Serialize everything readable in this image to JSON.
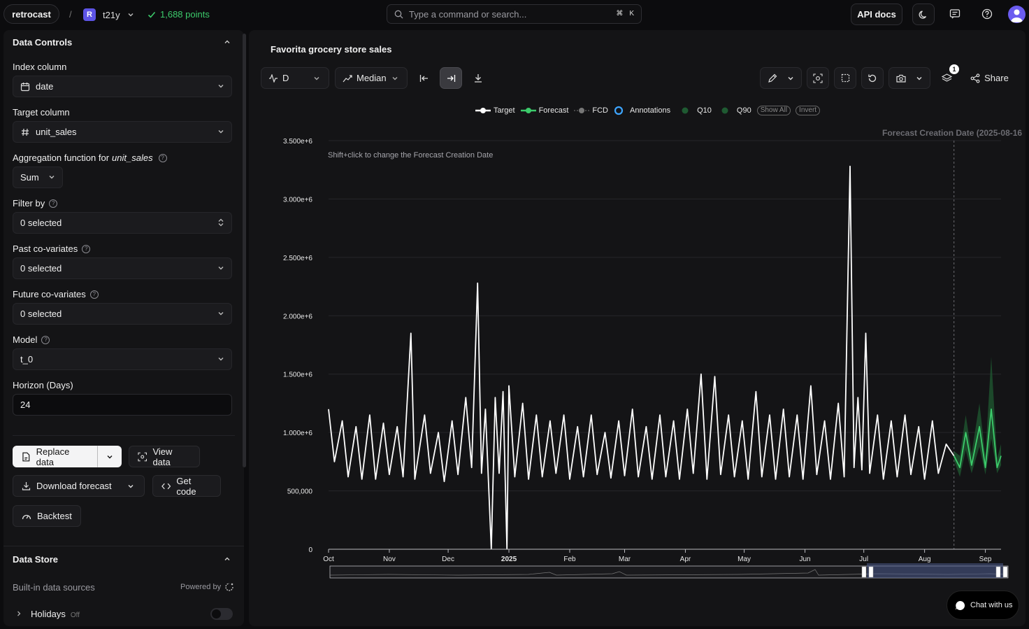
{
  "topbar": {
    "brand": "retrocast",
    "separator": "/",
    "workspace_badge": "R",
    "workspace": "t21y",
    "points": "1,688 points",
    "search_placeholder": "Type a command or search...",
    "shortcut_key_1": "⌘",
    "shortcut_key_2": "K",
    "api_docs": "API docs",
    "points_color": "#3ccb6b"
  },
  "sidebar": {
    "data_controls_title": "Data Controls",
    "index_column_label": "Index column",
    "index_column_value": "date",
    "target_column_label": "Target column",
    "target_column_value": "unit_sales",
    "aggregation_label_prefix": "Aggregation function for",
    "aggregation_label_field": "unit_sales",
    "aggregation_value": "Sum",
    "filter_label": "Filter by",
    "filter_value": "0 selected",
    "past_label": "Past co-variates",
    "past_value": "0 selected",
    "future_label": "Future co-variates",
    "future_value": "0 selected",
    "model_label": "Model",
    "model_value": "t_0",
    "horizon_label": "Horizon (Days)",
    "horizon_value": "24",
    "replace_data": "Replace data",
    "view_data": "View data",
    "download_forecast": "Download forecast",
    "get_code": "Get code",
    "backtest": "Backtest",
    "data_store_title": "Data Store",
    "builtin_label": "Built-in data sources",
    "powered_by": "Powered by",
    "holidays_label": "Holidays",
    "holidays_state": "Off"
  },
  "main": {
    "title": "Favorita grocery store sales",
    "frequency": "D",
    "quantile": "Median",
    "share": "Share",
    "layers_badge": "1",
    "hint": "Shift+click to change the Forecast Creation Date",
    "fcd_label": "Forecast Creation Date (2025-08-16",
    "legend": {
      "target": "Target",
      "forecast": "Forecast",
      "fcd": "FCD",
      "annotations": "Annotations",
      "q10": "Q10",
      "q90": "Q90",
      "show_all": "Show All",
      "invert": "Invert"
    }
  },
  "chat": {
    "label": "Chat with us"
  },
  "chart_data": {
    "type": "line",
    "title": "Favorita grocery store sales",
    "ylim": [
      0,
      3500000
    ],
    "y_ticks": [
      "0",
      "500,000",
      "1.000e+6",
      "1.500e+6",
      "2.000e+6",
      "2.500e+6",
      "3.000e+6",
      "3.500e+6"
    ],
    "x_ticks": [
      "Oct",
      "Nov",
      "Dec",
      "2025",
      "Feb",
      "Mar",
      "Apr",
      "May",
      "Jun",
      "Jul",
      "Aug",
      "Sep"
    ],
    "x_range": [
      "2024-10-01",
      "2025-09-09"
    ],
    "forecast_creation_date": "2025-08-16",
    "series": [
      {
        "name": "Target",
        "color": "#ffffff",
        "points": [
          [
            "2024-10-01",
            1200000
          ],
          [
            "2024-10-04",
            750000
          ],
          [
            "2024-10-08",
            1100000
          ],
          [
            "2024-10-11",
            620000
          ],
          [
            "2024-10-15",
            1050000
          ],
          [
            "2024-10-18",
            600000
          ],
          [
            "2024-10-22",
            1150000
          ],
          [
            "2024-10-25",
            600000
          ],
          [
            "2024-10-29",
            1080000
          ],
          [
            "2024-11-01",
            640000
          ],
          [
            "2024-11-05",
            1050000
          ],
          [
            "2024-11-08",
            620000
          ],
          [
            "2024-11-12",
            1850000
          ],
          [
            "2024-11-14",
            600000
          ],
          [
            "2024-11-19",
            1150000
          ],
          [
            "2024-11-22",
            650000
          ],
          [
            "2024-11-26",
            1000000
          ],
          [
            "2024-11-29",
            580000
          ],
          [
            "2024-12-03",
            1100000
          ],
          [
            "2024-12-06",
            640000
          ],
          [
            "2024-12-10",
            1300000
          ],
          [
            "2024-12-13",
            700000
          ],
          [
            "2024-12-16",
            2280000
          ],
          [
            "2024-12-18",
            650000
          ],
          [
            "2024-12-20",
            1200000
          ],
          [
            "2024-12-23",
            2000
          ],
          [
            "2024-12-25",
            1300000
          ],
          [
            "2024-12-27",
            650000
          ],
          [
            "2024-12-29",
            1350000
          ],
          [
            "2024-12-31",
            2000
          ],
          [
            "2025-01-01",
            1400000
          ],
          [
            "2025-01-04",
            620000
          ],
          [
            "2025-01-08",
            1250000
          ],
          [
            "2025-01-11",
            600000
          ],
          [
            "2025-01-15",
            1150000
          ],
          [
            "2025-01-18",
            620000
          ],
          [
            "2025-01-22",
            1100000
          ],
          [
            "2025-01-25",
            650000
          ],
          [
            "2025-01-29",
            1150000
          ],
          [
            "2025-02-01",
            600000
          ],
          [
            "2025-02-05",
            1050000
          ],
          [
            "2025-02-08",
            620000
          ],
          [
            "2025-02-12",
            1150000
          ],
          [
            "2025-02-15",
            640000
          ],
          [
            "2025-02-19",
            1000000
          ],
          [
            "2025-02-22",
            610000
          ],
          [
            "2025-02-26",
            1100000
          ],
          [
            "2025-03-01",
            630000
          ],
          [
            "2025-03-05",
            1200000
          ],
          [
            "2025-03-08",
            620000
          ],
          [
            "2025-03-12",
            1050000
          ],
          [
            "2025-03-15",
            600000
          ],
          [
            "2025-03-19",
            1150000
          ],
          [
            "2025-03-22",
            620000
          ],
          [
            "2025-03-26",
            1100000
          ],
          [
            "2025-03-29",
            600000
          ],
          [
            "2025-04-02",
            1200000
          ],
          [
            "2025-04-05",
            650000
          ],
          [
            "2025-04-09",
            1500000
          ],
          [
            "2025-04-12",
            600000
          ],
          [
            "2025-04-16",
            1480000
          ],
          [
            "2025-04-19",
            640000
          ],
          [
            "2025-04-23",
            1150000
          ],
          [
            "2025-04-26",
            620000
          ],
          [
            "2025-04-30",
            1100000
          ],
          [
            "2025-05-03",
            600000
          ],
          [
            "2025-05-07",
            1350000
          ],
          [
            "2025-05-10",
            620000
          ],
          [
            "2025-05-14",
            1150000
          ],
          [
            "2025-05-17",
            600000
          ],
          [
            "2025-05-21",
            1200000
          ],
          [
            "2025-05-24",
            620000
          ],
          [
            "2025-05-28",
            1150000
          ],
          [
            "2025-05-31",
            600000
          ],
          [
            "2025-06-04",
            1400000
          ],
          [
            "2025-06-07",
            640000
          ],
          [
            "2025-06-11",
            1100000
          ],
          [
            "2025-06-14",
            600000
          ],
          [
            "2025-06-18",
            1250000
          ],
          [
            "2025-06-21",
            620000
          ],
          [
            "2025-06-24",
            3280000
          ],
          [
            "2025-06-26",
            700000
          ],
          [
            "2025-06-28",
            1300000
          ],
          [
            "2025-06-30",
            680000
          ],
          [
            "2025-07-02",
            1850000
          ],
          [
            "2025-07-04",
            650000
          ],
          [
            "2025-07-08",
            1150000
          ],
          [
            "2025-07-11",
            600000
          ],
          [
            "2025-07-15",
            1100000
          ],
          [
            "2025-07-18",
            620000
          ],
          [
            "2025-07-22",
            1150000
          ],
          [
            "2025-07-25",
            640000
          ],
          [
            "2025-07-29",
            1050000
          ],
          [
            "2025-08-01",
            600000
          ],
          [
            "2025-08-05",
            1100000
          ],
          [
            "2025-08-08",
            650000
          ],
          [
            "2025-08-12",
            900000
          ],
          [
            "2025-08-16",
            800000
          ]
        ]
      },
      {
        "name": "Forecast",
        "color": "#3ccb6b",
        "points": [
          [
            "2025-08-16",
            800000
          ],
          [
            "2025-08-19",
            700000
          ],
          [
            "2025-08-22",
            1000000
          ],
          [
            "2025-08-25",
            720000
          ],
          [
            "2025-08-29",
            1050000
          ],
          [
            "2025-09-01",
            700000
          ],
          [
            "2025-09-04",
            1200000
          ],
          [
            "2025-09-07",
            700000
          ],
          [
            "2025-09-09",
            800000
          ]
        ]
      },
      {
        "name": "Q10",
        "color": "#1f5a32",
        "points": [
          [
            "2025-08-16",
            760000
          ],
          [
            "2025-08-19",
            620000
          ],
          [
            "2025-08-22",
            850000
          ],
          [
            "2025-08-25",
            650000
          ],
          [
            "2025-08-29",
            880000
          ],
          [
            "2025-09-01",
            640000
          ],
          [
            "2025-09-04",
            950000
          ],
          [
            "2025-09-07",
            650000
          ],
          [
            "2025-09-09",
            720000
          ]
        ]
      },
      {
        "name": "Q90",
        "color": "#1f5a32",
        "points": [
          [
            "2025-08-16",
            840000
          ],
          [
            "2025-08-19",
            800000
          ],
          [
            "2025-08-22",
            1150000
          ],
          [
            "2025-08-25",
            820000
          ],
          [
            "2025-08-29",
            1250000
          ],
          [
            "2025-09-01",
            800000
          ],
          [
            "2025-09-04",
            1650000
          ],
          [
            "2025-09-07",
            780000
          ],
          [
            "2025-09-09",
            900000
          ]
        ]
      }
    ]
  }
}
